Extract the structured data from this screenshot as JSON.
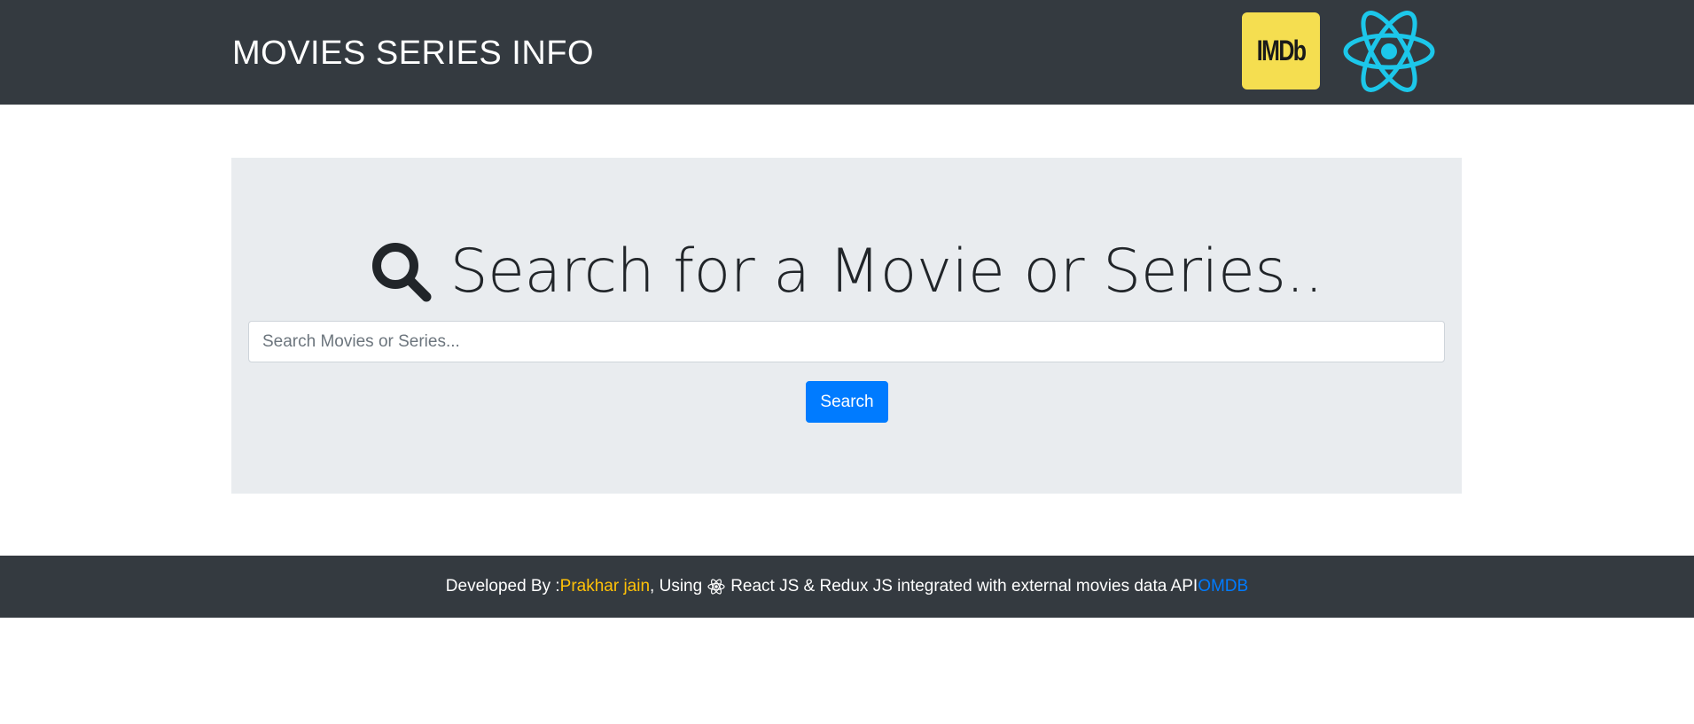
{
  "navbar": {
    "brand": "MOVIES SERIES INFO",
    "imdb_logo_text": "IMDb",
    "imdb_logo_color": "#f5de50",
    "react_logo_icon": "react-atom-icon",
    "react_logo_color": "#1cc7ea",
    "background": "#343a40"
  },
  "search": {
    "heading_icon": "search-icon",
    "heading": "Search for a Movie or Series..",
    "placeholder": "Search Movies or Series...",
    "value": "",
    "button_label": "Search",
    "button_color": "#007bff",
    "panel_background": "#e9ecef"
  },
  "footer": {
    "prefix": "Developed By :",
    "author": "Prakhar jain",
    "using": ", Using",
    "atom_icon": "react-atom-icon",
    "description": "React JS & Redux JS integrated with external movies data API",
    "api_name": "OMDB",
    "author_color": "#ffc107",
    "api_color": "#007bff"
  }
}
